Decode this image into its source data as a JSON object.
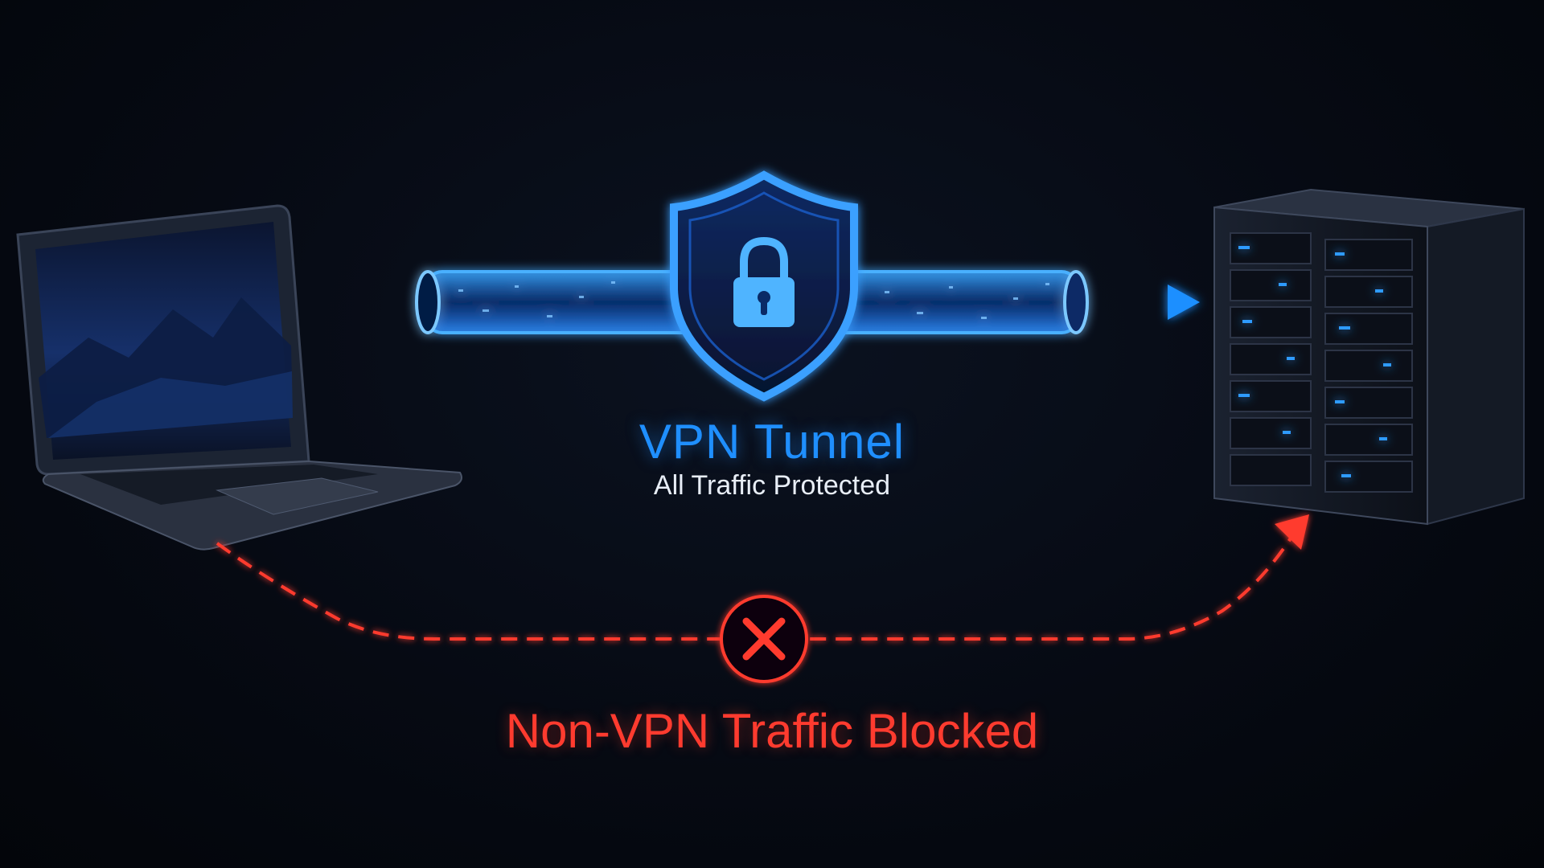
{
  "tunnel": {
    "title": "VPN Tunnel",
    "subtitle": "All Traffic Protected"
  },
  "blocked": {
    "label": "Non-VPN Traffic Blocked"
  },
  "colors": {
    "tunnel_blue": "#1f8fff",
    "blocked_red": "#ff3b2f",
    "background": "#05080f"
  },
  "icons": {
    "device": "laptop-icon",
    "destination": "server-rack-icon",
    "security": "shield-lock-icon",
    "blocked": "x-circle-icon"
  }
}
